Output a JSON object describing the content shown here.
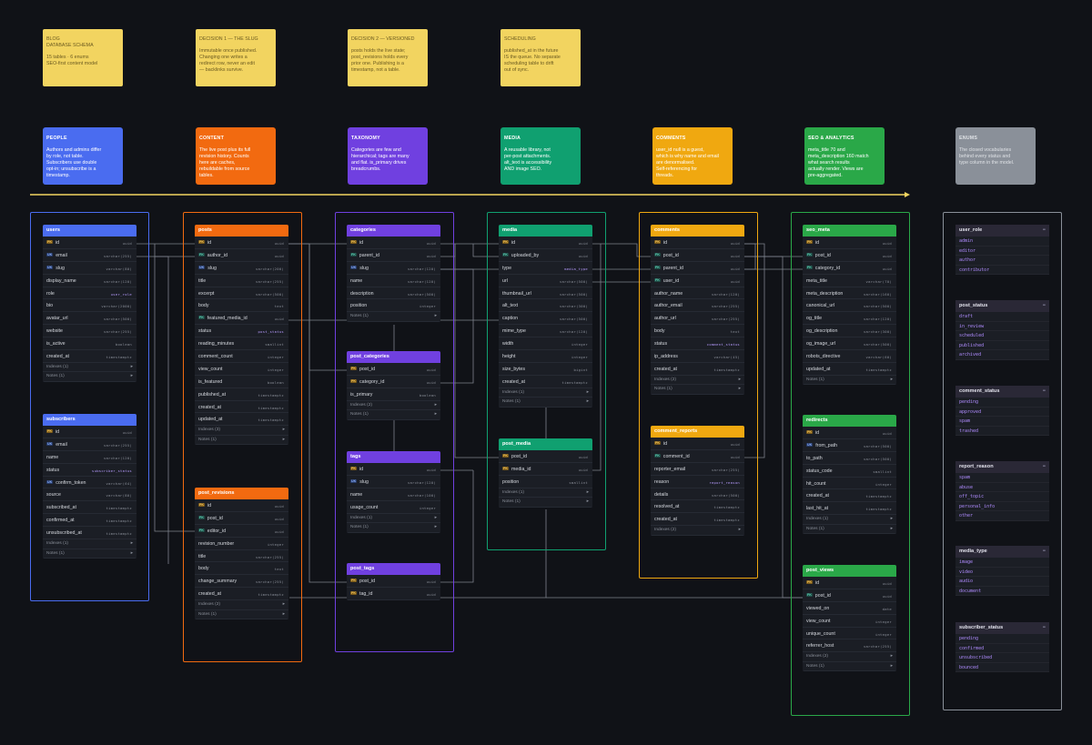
{
  "notes": [
    {
      "title": "BLOG\nDATABASE SCHEMA",
      "text": "15 tables · 6 enums\nSEO-first content model"
    },
    {
      "title": "DECISION 1 — THE SLUG",
      "text": "Immutable once published.\nChanging one writes a\nredirect row, never an edit\n— backlinks survive."
    },
    {
      "title": "DECISION 2 — VERSIONED",
      "text": "posts holds the live state;\npost_revisions holds every\nprior one. Publishing is a\ntimestamp, not a table."
    },
    {
      "title": "SCHEDULING",
      "text": "published_at in the future\nIS the queue. No separate\nscheduling table to drift\nout of sync."
    }
  ],
  "categories": [
    {
      "title": "PEOPLE",
      "text": "Authors and admins differ\nby role, not table.\nSubscribers use double\nopt-in; unsubscribe is a\ntimestamp.",
      "color": "#4a6cf0",
      "fg": "#ffffff"
    },
    {
      "title": "CONTENT",
      "text": "The live post plus its full\nrevision history. Counts\nhere are caches,\nrebuildable from source\ntables.",
      "color": "#f26a10",
      "fg": "#ffffff"
    },
    {
      "title": "TAXONOMY",
      "text": "Categories are few and\nhierarchical; tags are many\nand flat. is_primary drives\nbreadcrumbs.",
      "color": "#7040e0",
      "fg": "#ffffff"
    },
    {
      "title": "MEDIA",
      "text": "A reusable library, not\nper-post attachments.\nalt_text is accessibility\nAND image SEO.",
      "color": "#10a070",
      "fg": "#ffffff"
    },
    {
      "title": "COMMENTS",
      "text": "user_id null is a guest,\nwhich is why name and email\nare denormalised.\nSelf-referencing for\nthreads.",
      "color": "#f0a810",
      "fg": "#ffffff"
    },
    {
      "title": "SEO & ANALYTICS",
      "text": "meta_title 70 and\nmeta_description 160 match\nwhat search results\nactually render. Views are\npre-aggregated.",
      "color": "#2aa848",
      "fg": "#ffffff"
    },
    {
      "title": "ENUMS",
      "text": "The closed vocabularies\nbehind every status and\ntype column in the model.",
      "color": "#8a9099",
      "fg": "#dfe2e6"
    }
  ],
  "tables": {
    "users": {
      "name": "users",
      "color": "#4a6cf0",
      "rows": [
        [
          "PK",
          "id",
          "uuid"
        ],
        [
          "UK",
          "email",
          "varchar(255)"
        ],
        [
          "UK",
          "slug",
          "varchar(80)"
        ],
        [
          "",
          "display_name",
          "varchar(120)"
        ],
        [
          "",
          "role",
          "user_role"
        ],
        [
          "",
          "bio",
          "varchar(2000)"
        ],
        [
          "",
          "avatar_url",
          "varchar(500)"
        ],
        [
          "",
          "website",
          "varchar(255)"
        ],
        [
          "",
          "is_active",
          "boolean"
        ],
        [
          "",
          "created_at",
          "timestamptz"
        ]
      ],
      "foot": [
        "Indexes (1)",
        "Notes (1)"
      ]
    },
    "subscribers": {
      "name": "subscribers",
      "color": "#4a6cf0",
      "rows": [
        [
          "PK",
          "id",
          "uuid"
        ],
        [
          "UK",
          "email",
          "varchar(255)"
        ],
        [
          "",
          "name",
          "varchar(120)"
        ],
        [
          "",
          "status",
          "subscriber_status"
        ],
        [
          "UK",
          "confirm_token",
          "varchar(64)"
        ],
        [
          "",
          "source",
          "varchar(80)"
        ],
        [
          "",
          "subscribed_at",
          "timestamptz"
        ],
        [
          "",
          "confirmed_at",
          "timestamptz"
        ],
        [
          "",
          "unsubscribed_at",
          "timestamptz"
        ]
      ],
      "foot": [
        "Indexes (1)",
        "Notes (1)"
      ]
    },
    "posts": {
      "name": "posts",
      "color": "#f26a10",
      "rows": [
        [
          "PK",
          "id",
          "uuid"
        ],
        [
          "FK",
          "author_id",
          "uuid"
        ],
        [
          "UK",
          "slug",
          "varchar(200)"
        ],
        [
          "",
          "title",
          "varchar(255)"
        ],
        [
          "",
          "excerpt",
          "varchar(500)"
        ],
        [
          "",
          "body",
          "text"
        ],
        [
          "FK",
          "featured_media_id",
          "uuid"
        ],
        [
          "",
          "status",
          "post_status"
        ],
        [
          "",
          "reading_minutes",
          "smallint"
        ],
        [
          "",
          "comment_count",
          "integer"
        ],
        [
          "",
          "view_count",
          "integer"
        ],
        [
          "",
          "is_featured",
          "boolean"
        ],
        [
          "",
          "published_at",
          "timestamptz"
        ],
        [
          "",
          "created_at",
          "timestamptz"
        ],
        [
          "",
          "updated_at",
          "timestamptz"
        ]
      ],
      "foot": [
        "Indexes (3)",
        "Notes (1)"
      ]
    },
    "post_revisions": {
      "name": "post_revisions",
      "color": "#f26a10",
      "rows": [
        [
          "PK",
          "id",
          "uuid"
        ],
        [
          "FK",
          "post_id",
          "uuid"
        ],
        [
          "FK",
          "editor_id",
          "uuid"
        ],
        [
          "",
          "revision_number",
          "integer"
        ],
        [
          "",
          "title",
          "varchar(255)"
        ],
        [
          "",
          "body",
          "text"
        ],
        [
          "",
          "change_summary",
          "varchar(255)"
        ],
        [
          "",
          "created_at",
          "timestamptz"
        ]
      ],
      "foot": [
        "Indexes (2)",
        "Notes (1)"
      ]
    },
    "categories": {
      "name": "categories",
      "color": "#7040e0",
      "rows": [
        [
          "PK",
          "id",
          "uuid"
        ],
        [
          "FK",
          "parent_id",
          "uuid"
        ],
        [
          "UK",
          "slug",
          "varchar(120)"
        ],
        [
          "",
          "name",
          "varchar(120)"
        ],
        [
          "",
          "description",
          "varchar(500)"
        ],
        [
          "",
          "position",
          "integer"
        ]
      ],
      "foot": [
        "Notes (1)"
      ]
    },
    "post_categories": {
      "name": "post_categories",
      "color": "#7040e0",
      "rows": [
        [
          "PK",
          "post_id",
          "uuid"
        ],
        [
          "PK",
          "category_id",
          "uuid"
        ],
        [
          "",
          "is_primary",
          "boolean"
        ]
      ],
      "foot": [
        "Indexes (2)",
        "Notes (1)"
      ]
    },
    "tags": {
      "name": "tags",
      "color": "#7040e0",
      "rows": [
        [
          "PK",
          "id",
          "uuid"
        ],
        [
          "UK",
          "slug",
          "varchar(120)"
        ],
        [
          "",
          "name",
          "varchar(100)"
        ],
        [
          "",
          "usage_count",
          "integer"
        ]
      ],
      "foot": [
        "Indexes (1)",
        "Notes (1)"
      ]
    },
    "post_tags": {
      "name": "post_tags",
      "color": "#7040e0",
      "rows": [
        [
          "PK",
          "post_id",
          "uuid"
        ],
        [
          "PK",
          "tag_id",
          "uuid"
        ]
      ],
      "foot": []
    },
    "media": {
      "name": "media",
      "color": "#10a070",
      "rows": [
        [
          "PK",
          "id",
          "uuid"
        ],
        [
          "FK",
          "uploaded_by",
          "uuid"
        ],
        [
          "",
          "type",
          "media_type"
        ],
        [
          "",
          "url",
          "varchar(500)"
        ],
        [
          "",
          "thumbnail_url",
          "varchar(500)"
        ],
        [
          "",
          "alt_text",
          "varchar(300)"
        ],
        [
          "",
          "caption",
          "varchar(500)"
        ],
        [
          "",
          "mime_type",
          "varchar(120)"
        ],
        [
          "",
          "width",
          "integer"
        ],
        [
          "",
          "height",
          "integer"
        ],
        [
          "",
          "size_bytes",
          "bigint"
        ],
        [
          "",
          "created_at",
          "timestamptz"
        ]
      ],
      "foot": [
        "Indexes (1)",
        "Notes (1)"
      ]
    },
    "post_media": {
      "name": "post_media",
      "color": "#10a070",
      "rows": [
        [
          "PK",
          "post_id",
          "uuid"
        ],
        [
          "PK",
          "media_id",
          "uuid"
        ],
        [
          "",
          "position",
          "smallint"
        ]
      ],
      "foot": [
        "Indexes (1)",
        "Notes (1)"
      ]
    },
    "comments": {
      "name": "comments",
      "color": "#f0a810",
      "rows": [
        [
          "PK",
          "id",
          "uuid"
        ],
        [
          "FK",
          "post_id",
          "uuid"
        ],
        [
          "FK",
          "parent_id",
          "uuid"
        ],
        [
          "FK",
          "user_id",
          "uuid"
        ],
        [
          "",
          "author_name",
          "varchar(120)"
        ],
        [
          "",
          "author_email",
          "varchar(255)"
        ],
        [
          "",
          "author_url",
          "varchar(255)"
        ],
        [
          "",
          "body",
          "text"
        ],
        [
          "",
          "status",
          "comment_status"
        ],
        [
          "",
          "ip_address",
          "varchar(45)"
        ],
        [
          "",
          "created_at",
          "timestamptz"
        ]
      ],
      "foot": [
        "Indexes (2)",
        "Notes (1)"
      ]
    },
    "comment_reports": {
      "name": "comment_reports",
      "color": "#f0a810",
      "rows": [
        [
          "PK",
          "id",
          "uuid"
        ],
        [
          "FK",
          "comment_id",
          "uuid"
        ],
        [
          "",
          "reporter_email",
          "varchar(255)"
        ],
        [
          "",
          "reason",
          "report_reason"
        ],
        [
          "",
          "details",
          "varchar(500)"
        ],
        [
          "",
          "resolved_at",
          "timestamptz"
        ],
        [
          "",
          "created_at",
          "timestamptz"
        ]
      ],
      "foot": [
        "Indexes (2)"
      ]
    },
    "seo_meta": {
      "name": "seo_meta",
      "color": "#2aa848",
      "rows": [
        [
          "PK",
          "id",
          "uuid"
        ],
        [
          "FK",
          "post_id",
          "uuid"
        ],
        [
          "FK",
          "category_id",
          "uuid"
        ],
        [
          "",
          "meta_title",
          "varchar(70)"
        ],
        [
          "",
          "meta_description",
          "varchar(160)"
        ],
        [
          "",
          "canonical_url",
          "varchar(500)"
        ],
        [
          "",
          "og_title",
          "varchar(120)"
        ],
        [
          "",
          "og_description",
          "varchar(300)"
        ],
        [
          "",
          "og_image_url",
          "varchar(500)"
        ],
        [
          "",
          "robots_directive",
          "varchar(60)"
        ],
        [
          "",
          "updated_at",
          "timestamptz"
        ]
      ],
      "foot": [
        "Notes (1)"
      ]
    },
    "redirects": {
      "name": "redirects",
      "color": "#2aa848",
      "rows": [
        [
          "PK",
          "id",
          "uuid"
        ],
        [
          "UK",
          "from_path",
          "varchar(500)"
        ],
        [
          "",
          "to_path",
          "varchar(500)"
        ],
        [
          "",
          "status_code",
          "smallint"
        ],
        [
          "",
          "hit_count",
          "integer"
        ],
        [
          "",
          "created_at",
          "timestamptz"
        ],
        [
          "",
          "last_hit_at",
          "timestamptz"
        ]
      ],
      "foot": [
        "Indexes (1)",
        "Notes (1)"
      ]
    },
    "post_views": {
      "name": "post_views",
      "color": "#2aa848",
      "rows": [
        [
          "PK",
          "id",
          "uuid"
        ],
        [
          "FK",
          "post_id",
          "uuid"
        ],
        [
          "",
          "viewed_on",
          "date"
        ],
        [
          "",
          "view_count",
          "integer"
        ],
        [
          "",
          "unique_count",
          "integer"
        ],
        [
          "",
          "referrer_host",
          "varchar(255)"
        ]
      ],
      "foot": [
        "Indexes (2)",
        "Notes (1)"
      ]
    }
  },
  "enums": [
    {
      "name": "user_role",
      "values": [
        "admin",
        "editor",
        "author",
        "contributor"
      ]
    },
    {
      "name": "post_status",
      "values": [
        "draft",
        "in_review",
        "scheduled",
        "published",
        "archived"
      ]
    },
    {
      "name": "comment_status",
      "values": [
        "pending",
        "approved",
        "spam",
        "trashed"
      ]
    },
    {
      "name": "report_reason",
      "values": [
        "spam",
        "abuse",
        "off_topic",
        "personal_info",
        "other"
      ]
    },
    {
      "name": "media_type",
      "values": [
        "image",
        "video",
        "audio",
        "document"
      ]
    },
    {
      "name": "subscriber_status",
      "values": [
        "pending",
        "confirmed",
        "unsubscribed",
        "bounced"
      ]
    }
  ],
  "key_labels": {
    "PK": "PK",
    "FK": "FK",
    "UK": "UK"
  },
  "arrow_glyph": "▸",
  "enum_dots_glyph": "•••",
  "enum_types": [
    "user_role",
    "subscriber_status",
    "post_status",
    "media_type",
    "comment_status",
    "report_reason"
  ],
  "colors": {
    "background": "#101217",
    "timeline": "#f2d460",
    "note": "#f2d460",
    "people": "#4a6cf0",
    "content": "#f26a10",
    "taxonomy": "#7040e0",
    "media": "#10a070",
    "comments": "#f0a810",
    "seo": "#2aa848",
    "enums": "#8a9099"
  }
}
